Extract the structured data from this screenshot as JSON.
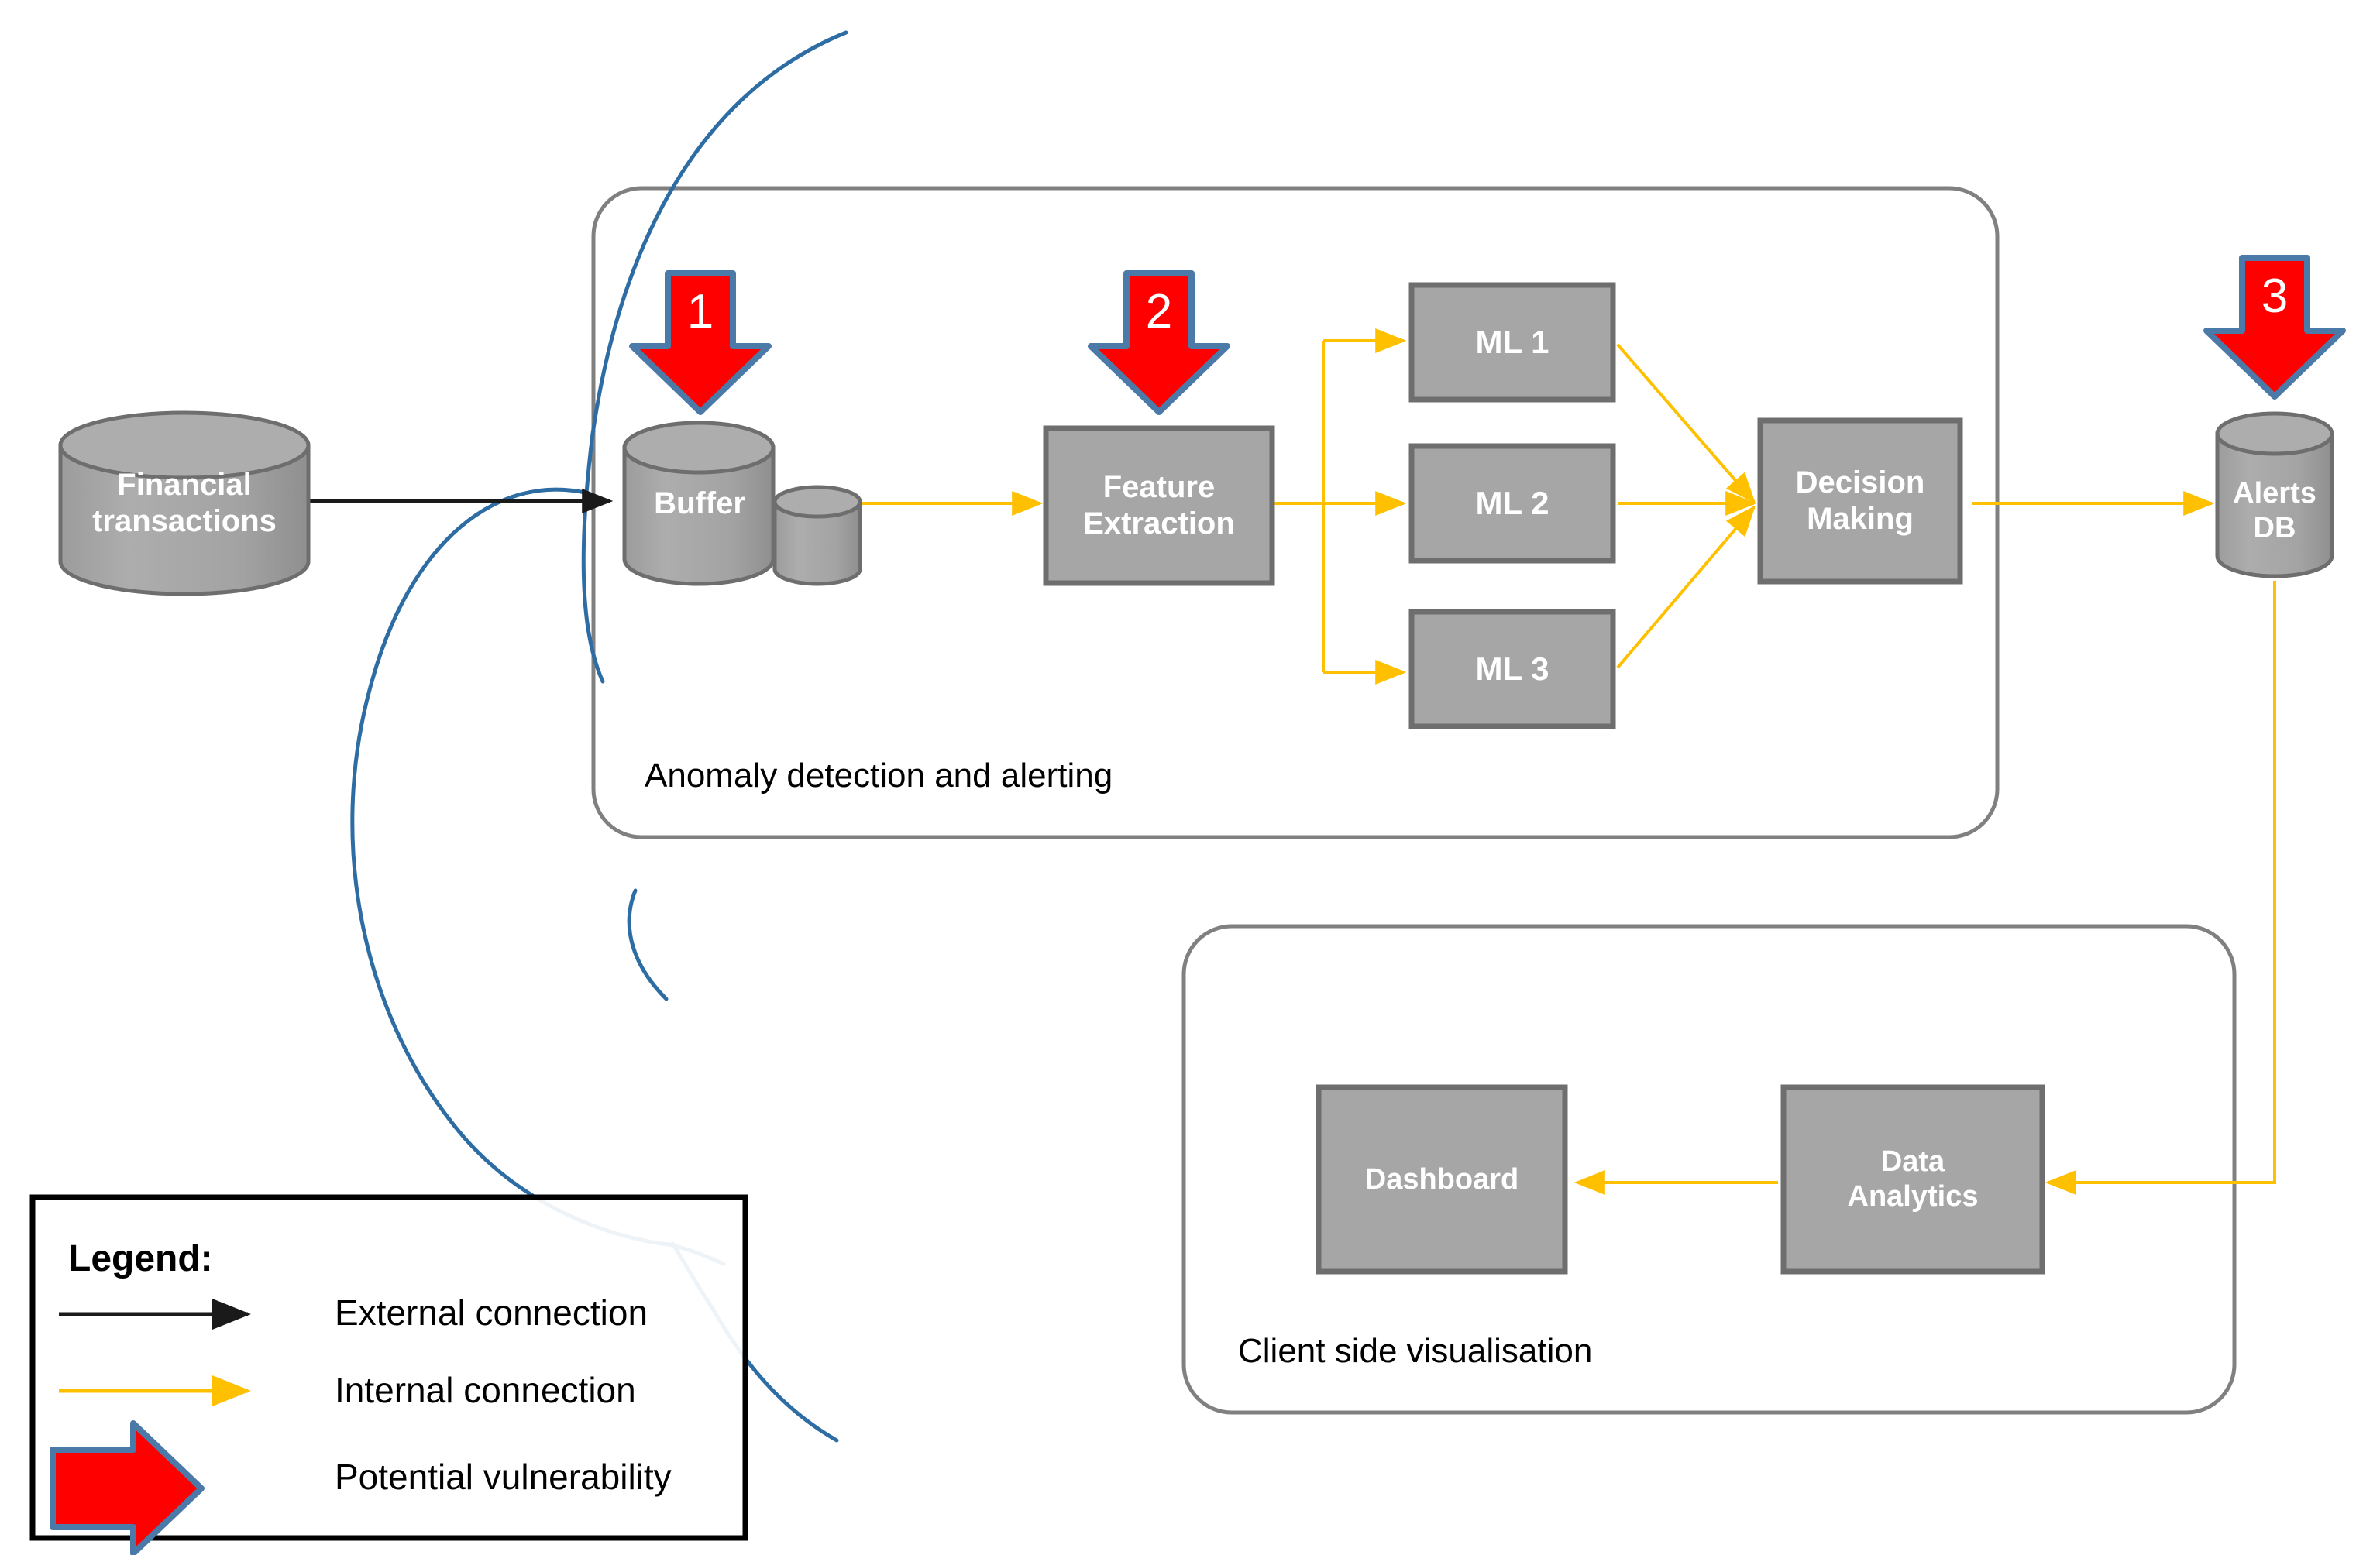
{
  "colors": {
    "node_fill": "#a6a6a6",
    "node_stroke": "#6e6e6e",
    "node_text": "#ffffff",
    "group_stroke": "#808080",
    "internal_connection": "#ffc000",
    "external_connection": "#1a1a1a",
    "vulnerability_fill": "#ff0000",
    "vulnerability_stroke": "#4c7aa8",
    "overlay_curve": "#2e6da4",
    "legend_border": "#000000",
    "background": "#ffffff"
  },
  "nodes": {
    "financial_transactions": {
      "label_line1": "Financial",
      "label_line2": "transactions",
      "shape": "cylinder"
    },
    "buffer": {
      "label_line1": "Buffer",
      "shape": "cylinder"
    },
    "feature_extraction": {
      "label_line1": "Feature",
      "label_line2": "Extraction",
      "shape": "rect"
    },
    "ml1": {
      "label_line1": "ML 1",
      "shape": "rect"
    },
    "ml2": {
      "label_line1": "ML 2",
      "shape": "rect"
    },
    "ml3": {
      "label_line1": "ML 3",
      "shape": "rect"
    },
    "decision_making": {
      "label_line1": "Decision",
      "label_line2": "Making",
      "shape": "rect"
    },
    "alerts_db": {
      "label_line1": "Alerts",
      "label_line2": "DB",
      "shape": "cylinder"
    },
    "dashboard": {
      "label_line1": "Dashboard",
      "shape": "rect"
    },
    "data_analytics": {
      "label_line1": "Data",
      "label_line2": "Analytics",
      "shape": "rect"
    }
  },
  "groups": {
    "anomaly_detection": {
      "label": "Anomaly detection and alerting"
    },
    "client_side": {
      "label": "Client side visualisation"
    }
  },
  "vulnerability_markers": [
    {
      "id": 1,
      "number": "1",
      "target": "buffer"
    },
    {
      "id": 2,
      "number": "2",
      "target": "feature-extraction"
    },
    {
      "id": 3,
      "number": "3",
      "target": "alerts-db"
    }
  ],
  "legend": {
    "title": "Legend:",
    "items": [
      {
        "key": "external",
        "label": "External connection",
        "style": "black-arrow"
      },
      {
        "key": "internal",
        "label": "Internal connection",
        "style": "yellow-arrow"
      },
      {
        "key": "vulnerability",
        "label": "Potential vulnerability",
        "style": "red-block-arrow"
      }
    ]
  },
  "chart_data": {
    "type": "diagram",
    "title": "Anomaly detection and alerting architecture",
    "edges": [
      {
        "from": "financial_transactions",
        "to": "buffer",
        "kind": "external"
      },
      {
        "from": "buffer",
        "to": "feature_extraction",
        "kind": "internal"
      },
      {
        "from": "feature_extraction",
        "to": "ml1",
        "kind": "internal"
      },
      {
        "from": "feature_extraction",
        "to": "ml2",
        "kind": "internal"
      },
      {
        "from": "feature_extraction",
        "to": "ml3",
        "kind": "internal"
      },
      {
        "from": "ml1",
        "to": "decision_making",
        "kind": "internal"
      },
      {
        "from": "ml2",
        "to": "decision_making",
        "kind": "internal"
      },
      {
        "from": "ml3",
        "to": "decision_making",
        "kind": "internal"
      },
      {
        "from": "decision_making",
        "to": "alerts_db",
        "kind": "internal"
      },
      {
        "from": "alerts_db",
        "to": "data_analytics",
        "kind": "internal"
      },
      {
        "from": "data_analytics",
        "to": "dashboard",
        "kind": "internal"
      }
    ]
  }
}
